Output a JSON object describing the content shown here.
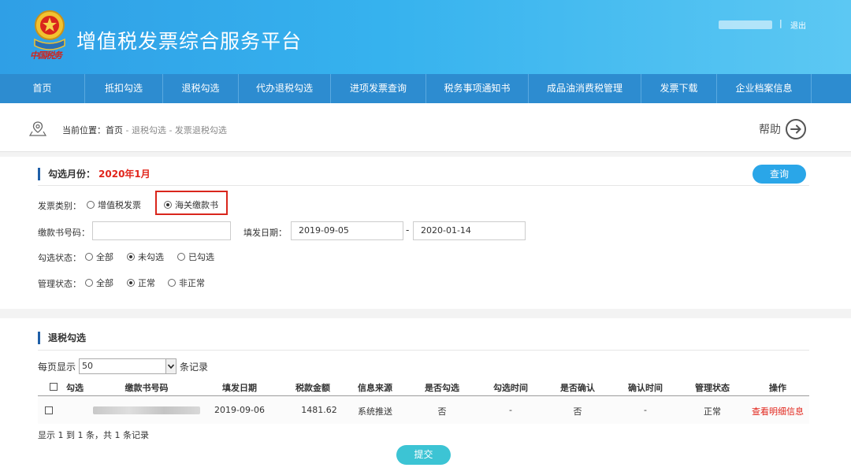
{
  "header": {
    "emblem_text": "中国税务",
    "title": "增值税发票综合服务平台",
    "separator": "|",
    "logout_label": "退出"
  },
  "nav": {
    "items": [
      {
        "label": "首页"
      },
      {
        "label": "抵扣勾选"
      },
      {
        "label": "退税勾选"
      },
      {
        "label": "代办退税勾选"
      },
      {
        "label": "进项发票查询"
      },
      {
        "label": "税务事项通知书"
      },
      {
        "label": "成品油消费税管理"
      },
      {
        "label": "发票下载"
      },
      {
        "label": "企业档案信息"
      }
    ]
  },
  "breadcrumb": {
    "prefix": "当前位置：",
    "home": "首页",
    "path": " - 退税勾选 - 发票退税勾选",
    "help_label": "帮助"
  },
  "query": {
    "title": "勾选月份：",
    "month": "2020年1月",
    "query_button": "查询",
    "invoice_type_label": "发票类别：",
    "invoice_types": [
      "增值税发票",
      "海关缴款书"
    ],
    "invoice_type_selected": "海关缴款书",
    "payment_no_label": "缴款书号码：",
    "payment_no_value": "",
    "issue_date_label": "填发日期：",
    "date_from": "2019-09-05",
    "date_sep": "-",
    "date_to": "2020-01-14",
    "check_status_label": "勾选状态：",
    "check_status_options": [
      "全部",
      "未勾选",
      "已勾选"
    ],
    "check_status_selected": "未勾选",
    "manage_status_label": "管理状态：",
    "manage_status_options": [
      "全部",
      "正常",
      "非正常"
    ],
    "manage_status_selected": "正常"
  },
  "results": {
    "title": "退税勾选",
    "per_page_prefix": "每页显示",
    "per_page_value": "50",
    "per_page_suffix": "条记录",
    "columns": [
      "勾选",
      "缴款书号码",
      "填发日期",
      "税款金额",
      "信息来源",
      "是否勾选",
      "勾选时间",
      "是否确认",
      "确认时间",
      "管理状态",
      "操作"
    ],
    "rows": [
      {
        "date": "2019-09-06",
        "amount": "1481.62",
        "source": "系统推送",
        "checked": "否",
        "check_time": "-",
        "confirmed": "否",
        "confirm_time": "-",
        "manage_status": "正常",
        "action": "查看明细信息"
      }
    ],
    "record_info": "显示 1 到 1 条，共 1 条记录",
    "submit_label": "提交"
  }
}
